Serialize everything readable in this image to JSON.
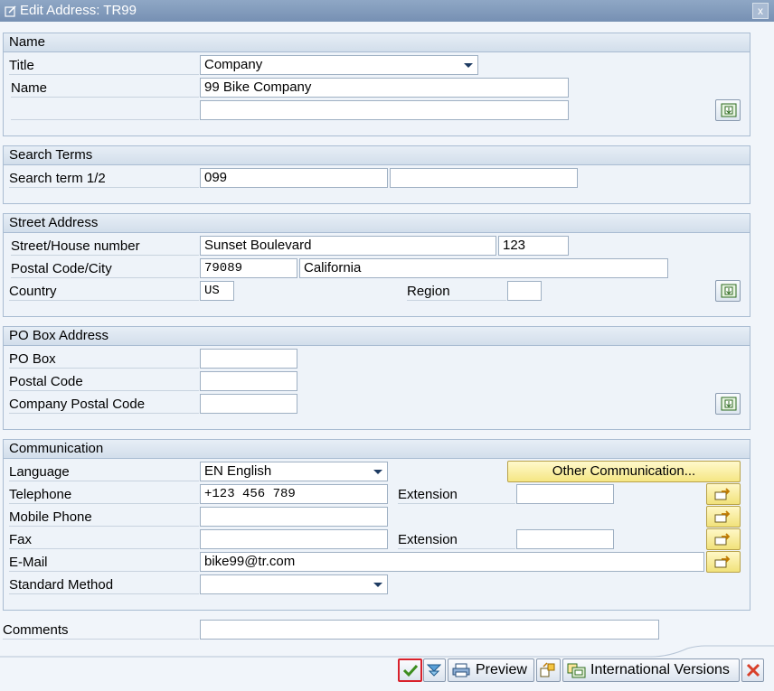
{
  "window": {
    "title": "Edit Address:  TR99",
    "close_label": "x"
  },
  "name_group": {
    "header": "Name",
    "title_label": "Title",
    "title_value": "Company",
    "name_label": "Name",
    "name_value": "99 Bike Company",
    "name2_value": ""
  },
  "search_group": {
    "header": "Search Terms",
    "search_label": "Search term 1/2",
    "search1_value": "099",
    "search2_value": ""
  },
  "street_group": {
    "header": "Street Address",
    "street_label": "Street/House number",
    "street_value": "Sunset Boulevard",
    "house_value": "123",
    "postal_city_label": "Postal Code/City",
    "postal_value": "79089",
    "city_value": "California",
    "country_label": "Country",
    "country_value": "US",
    "region_label": "Region",
    "region_value": ""
  },
  "pobox_group": {
    "header": "PO Box Address",
    "pobox_label": "PO Box",
    "pobox_value": "",
    "postal_code_label": "Postal Code",
    "postal_code_value": "",
    "company_postal_label": "Company Postal Code",
    "company_postal_value": ""
  },
  "comm_group": {
    "header": "Communication",
    "language_label": "Language",
    "language_value": "EN English",
    "other_comm_label": "Other Communication...",
    "telephone_label": "Telephone",
    "telephone_value": "+123 456 789",
    "extension_label": "Extension",
    "tel_extension_value": "",
    "mobile_label": "Mobile Phone",
    "mobile_value": "",
    "fax_label": "Fax",
    "fax_value": "",
    "fax_extension_label": "Extension",
    "fax_extension_value": "",
    "email_label": "E-Mail",
    "email_value": "bike99@tr.com",
    "std_method_label": "Standard Method",
    "std_method_value": ""
  },
  "comments": {
    "label": "Comments",
    "value": ""
  },
  "footer": {
    "preview_label": "Preview",
    "intl_versions_label": "International Versions"
  },
  "colors": {
    "titlebar": "#7f98ba",
    "group_header": "#d9e3ee",
    "yellow_button": "#f5e683",
    "confirm_outline": "#d9212b",
    "cancel_red": "#d8402a"
  }
}
